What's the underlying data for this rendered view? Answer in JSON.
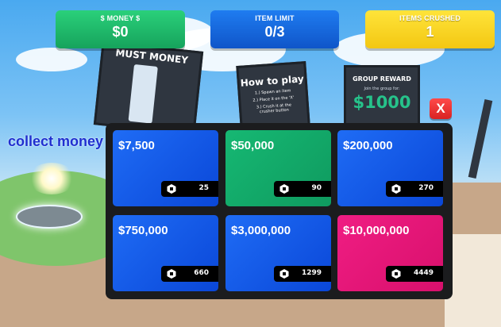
{
  "hud": {
    "money": {
      "label": "$ MONEY $",
      "value": "$0"
    },
    "item_limit": {
      "label": "ITEM LIMIT",
      "value": "0/3"
    },
    "items_crushed": {
      "label": "ITEMS CRUSHED",
      "value": "1"
    }
  },
  "world": {
    "board_money_title": "MUST MONEY",
    "board_howto_title": "How to play",
    "board_howto_lines": [
      "1.) Spawn an item",
      "2.) Place it on the 'X'",
      "3.) Crush it at the",
      "crusher button"
    ],
    "board_group_title": "GROUP REWARD",
    "board_group_sub": "Join the group for:",
    "board_group_amount": "$1000",
    "collect_text": "collect money"
  },
  "shop": {
    "close_label": "X",
    "items": [
      {
        "price": "$7,500",
        "robux": "25",
        "color": "#1f6cf5"
      },
      {
        "price": "$50,000",
        "robux": "90",
        "color": "#16b873"
      },
      {
        "price": "$200,000",
        "robux": "270",
        "color": "#1f6cf5"
      },
      {
        "price": "$750,000",
        "robux": "660",
        "color": "#1f6cf5"
      },
      {
        "price": "$3,000,000",
        "robux": "1299",
        "color": "#1f6cf5"
      },
      {
        "price": "$10,000,000",
        "robux": "4449",
        "color": "#f01d83"
      }
    ]
  }
}
